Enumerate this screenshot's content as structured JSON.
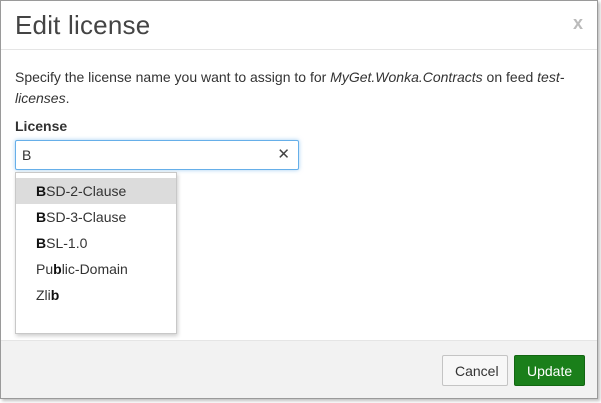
{
  "dialog": {
    "title": "Edit license",
    "close_glyph": "x",
    "description": {
      "prefix": "Specify the license name you want to assign to for ",
      "package": "MyGet.Wonka.Contracts",
      "middle": " on feed ",
      "feed": "test-licenses",
      "suffix": "."
    },
    "license_label": "License",
    "input_value": "B",
    "clear_glyph": "✕"
  },
  "options": [
    {
      "before": "",
      "match": "B",
      "after": "SD-2-Clause",
      "active": true
    },
    {
      "before": "",
      "match": "B",
      "after": "SD-3-Clause",
      "active": false
    },
    {
      "before": "",
      "match": "B",
      "after": "SL-1.0",
      "active": false
    },
    {
      "before": "Pu",
      "match": "b",
      "after": "lic-Domain",
      "active": false
    },
    {
      "before": "Zli",
      "match": "b",
      "after": "",
      "active": false
    }
  ],
  "footer": {
    "cancel_label": "Cancel",
    "update_label": "Update"
  },
  "colors": {
    "update_button": "#1a7f1a",
    "focus_border": "#66afe9",
    "active_option": "#dcdcdc"
  }
}
